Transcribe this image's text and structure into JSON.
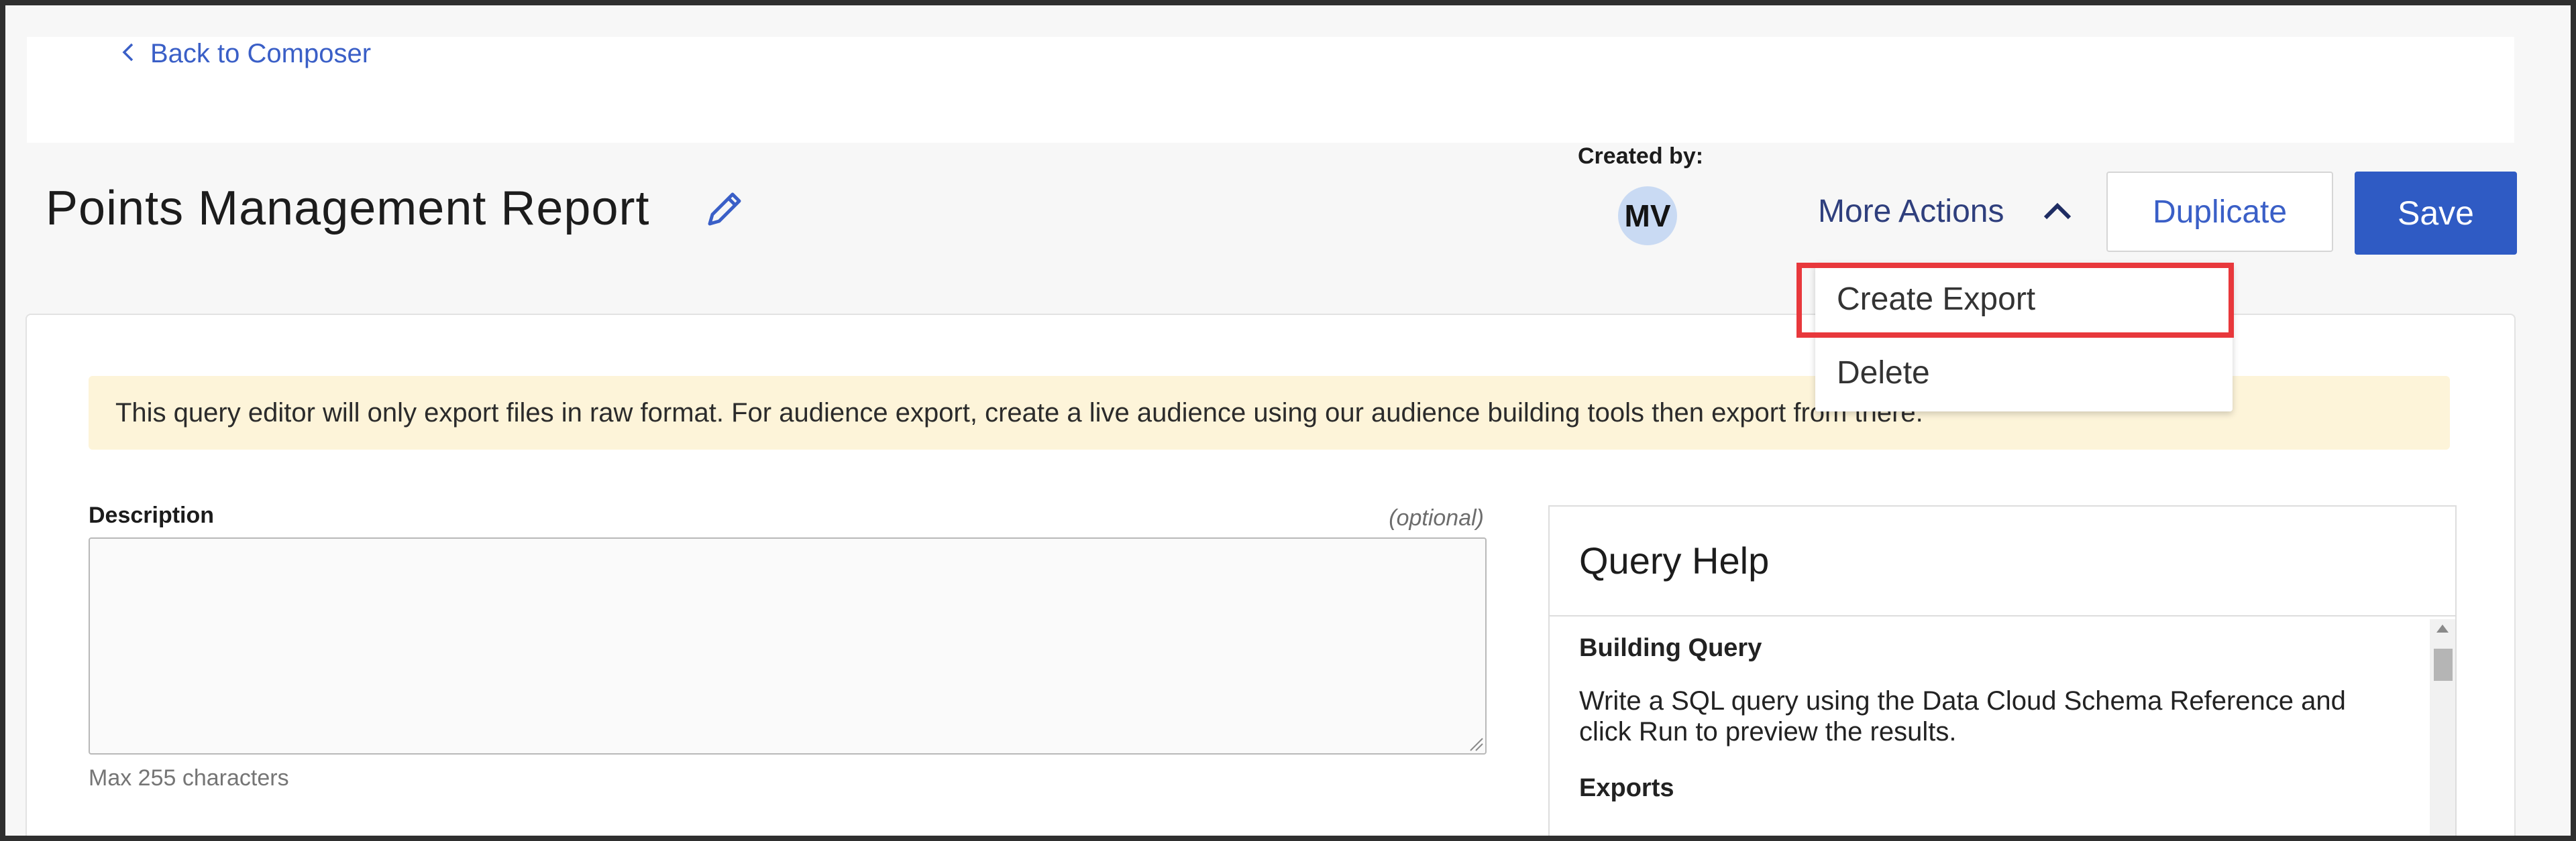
{
  "nav": {
    "back_label": "Back to Composer"
  },
  "header": {
    "title": "Points Management Report",
    "created_by_label": "Created by:",
    "creator_initials": "MV",
    "more_actions_label": "More Actions",
    "duplicate_label": "Duplicate",
    "save_label": "Save"
  },
  "dropdown": {
    "items": [
      {
        "label": "Create Export"
      },
      {
        "label": "Delete"
      }
    ]
  },
  "notice": {
    "text": "This query editor will only export files in raw format. For audience export, create a live audience using our audience building tools then export from there."
  },
  "description": {
    "label": "Description",
    "optional_label": "(optional)",
    "value": "",
    "hint": "Max 255 characters"
  },
  "help": {
    "title": "Query Help",
    "sections": [
      {
        "heading": "Building Query",
        "text": "Write a SQL query using the Data Cloud Schema Reference and click Run to preview the results."
      },
      {
        "heading": "Exports"
      }
    ]
  },
  "colors": {
    "accent": "#2f5bc4",
    "link": "#3a5fc7",
    "notice_bg": "#fdf4d9",
    "highlight": "#e8383c"
  }
}
